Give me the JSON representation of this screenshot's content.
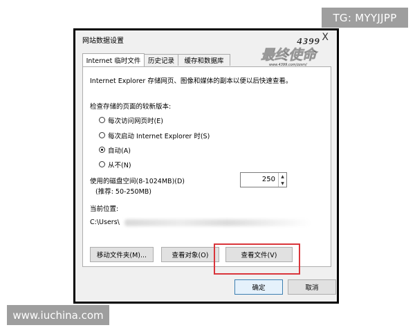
{
  "dialog": {
    "title": "网站数据设置",
    "close_glyph": "X"
  },
  "logo": {
    "top_text": "4399",
    "main_text": "最终使命",
    "url_text": "www.4399.com/zzsm/"
  },
  "tabs": [
    {
      "label": "Internet 临时文件",
      "active": true
    },
    {
      "label": "历史记录",
      "active": false
    },
    {
      "label": "缓存和数据库",
      "active": false
    }
  ],
  "content": {
    "description": "Internet Explorer 存储网页、图像和媒体的副本以便以后快速查看。",
    "check_label": "检查存储的页面的较新版本:",
    "radios": [
      {
        "label": "每次访问网页时(E)",
        "selected": false
      },
      {
        "label": "每次启动 Internet Explorer 时(S)",
        "selected": false
      },
      {
        "label": "自动(A)",
        "selected": true
      },
      {
        "label": "从不(N)",
        "selected": false
      }
    ],
    "disk_label_1": "使用的磁盘空间(8-1024MB)(D)",
    "disk_label_2": "(推荐: 50-250MB)",
    "disk_value": "250",
    "location_label": "当前位置:",
    "location_path": "C:\\Users\\"
  },
  "buttons": {
    "move_folder": "移动文件夹(M)...",
    "view_objects": "查看对象(O)",
    "view_files": "查看文件(V)",
    "ok": "确定",
    "cancel": "取消"
  },
  "watermarks": {
    "tg": "TG: MYYJJPP",
    "site": "www.iuchina.com"
  },
  "colors": {
    "highlight": "#d9343a",
    "watermark_bg": "#9e9e9e"
  }
}
